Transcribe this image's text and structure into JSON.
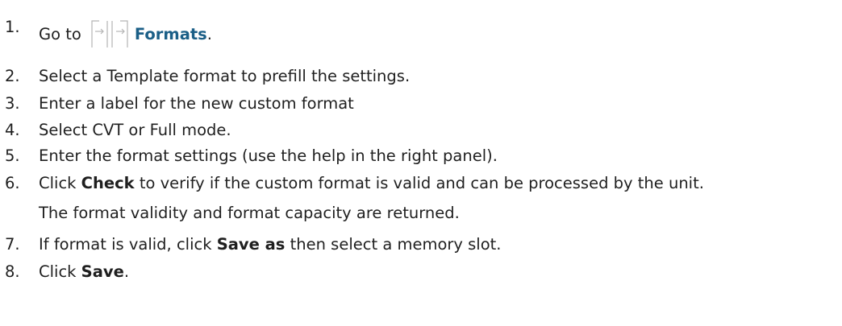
{
  "steps": [
    {
      "number": "1.",
      "parts": [
        {
          "text": "Go to",
          "style": "normal"
        },
        {
          "icon": "formats-icon"
        },
        {
          "text": "Formats",
          "style": "link"
        },
        {
          "text": ".",
          "style": "normal"
        }
      ]
    },
    {
      "number": "2.",
      "parts": [
        {
          "text": "Select a Template format to prefill the settings.",
          "style": "normal"
        }
      ]
    },
    {
      "number": "3.",
      "parts": [
        {
          "text": "Enter a label for the new custom format",
          "style": "normal"
        }
      ]
    },
    {
      "number": "4.",
      "parts": [
        {
          "text": "Select CVT or Full mode.",
          "style": "normal"
        }
      ]
    },
    {
      "number": "5.",
      "parts": [
        {
          "text": "Enter the format settings (use the help in the right panel).",
          "style": "normal"
        }
      ]
    },
    {
      "number": "6.",
      "parts": [
        {
          "text": "Click ",
          "style": "normal"
        },
        {
          "text": "Check",
          "style": "bold"
        },
        {
          "text": " to verify if the custom format is valid and can be processed by the unit.",
          "style": "normal"
        }
      ]
    },
    {
      "number": "",
      "parts": [
        {
          "text": "The format validity and format capacity are returned.",
          "style": "normal"
        }
      ]
    },
    {
      "number": "7.",
      "parts": [
        {
          "text": "If format is valid, click ",
          "style": "normal"
        },
        {
          "text": "Save as",
          "style": "bold"
        },
        {
          "text": " then select a memory slot.",
          "style": "normal"
        }
      ]
    },
    {
      "number": "8.",
      "parts": [
        {
          "text": "Click ",
          "style": "normal"
        },
        {
          "text": "Save",
          "style": "bold"
        },
        {
          "text": ".",
          "style": "normal"
        }
      ]
    }
  ],
  "colors": {
    "text": "#1f1f1f",
    "link": "#1b5f87",
    "icon": "#b5b5b5"
  }
}
